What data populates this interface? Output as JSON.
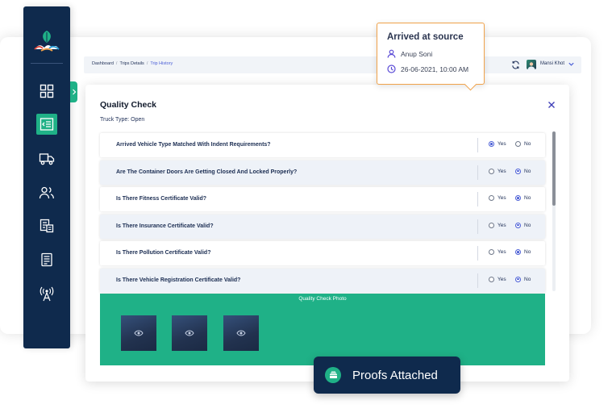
{
  "breadcrumb": {
    "items": [
      "Dashboard",
      "Trips Details",
      "Trip History"
    ],
    "separator": "/"
  },
  "user": {
    "name": "Mansi Khot"
  },
  "modal": {
    "title": "Quality Check",
    "truck_type": "Truck Type: Open",
    "questions": [
      {
        "text": "Arrived Vehicle Type Matched With Indent Requirements?",
        "selected": "Yes"
      },
      {
        "text": "Are The Container Doors Are Getting Closed And Locked Properly?",
        "selected": "No"
      },
      {
        "text": "Is There Fitness Certificate Valid?",
        "selected": "No"
      },
      {
        "text": "Is There Insurance Certificate Valid?",
        "selected": "No"
      },
      {
        "text": "Is There Pollution Certificate Valid?",
        "selected": "No"
      },
      {
        "text": "Is There Vehicle Registration Certificate Valid?",
        "selected": "No"
      }
    ],
    "yes_label": "Yes",
    "no_label": "No",
    "photo_label": "Quality Check Photo"
  },
  "arrived": {
    "title": "Arrived at source",
    "person": "Anup Soni",
    "time": "26-06-2021, 10:00 AM"
  },
  "proofs": {
    "label": "Proofs Attached"
  },
  "colors": {
    "navy": "#0f2a4d",
    "accent_green": "#1fb187",
    "radio_active": "#4b5fd6",
    "card_border": "#f0a24a",
    "card_icon": "#5b4bd6"
  },
  "icons": {
    "sidebar": [
      "dashboard-grid-icon",
      "trip-list-icon",
      "truck-icon",
      "users-icon",
      "documents-icon",
      "report-icon",
      "signal-tower-icon"
    ],
    "thumbnail": "eye-icon",
    "proofs": "stack-icon"
  }
}
